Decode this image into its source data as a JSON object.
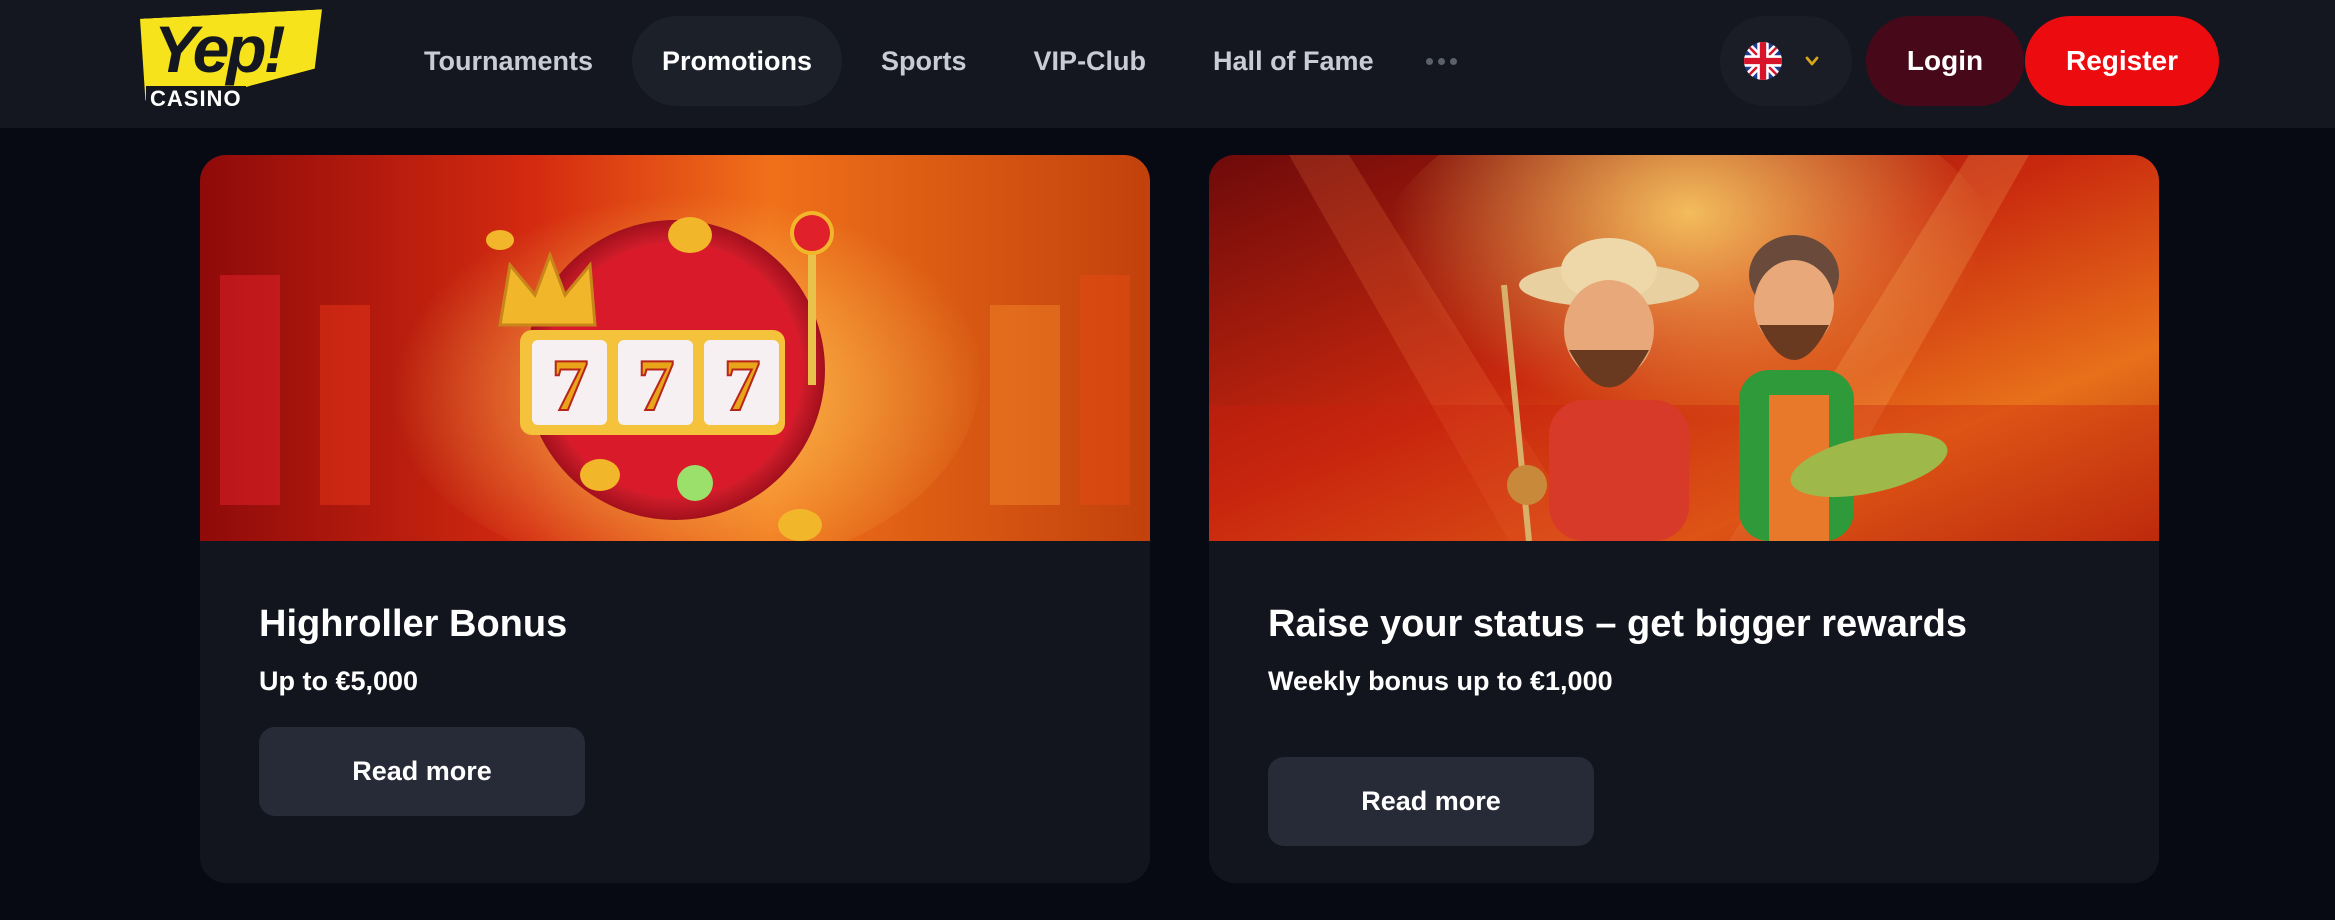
{
  "logo": {
    "brand": "Yep!",
    "sub": "CASINO"
  },
  "nav": {
    "items": [
      {
        "label": "Tournaments"
      },
      {
        "label": "Promotions",
        "active": true
      },
      {
        "label": "Sports"
      },
      {
        "label": "VIP-Club"
      },
      {
        "label": "Hall of Fame"
      }
    ],
    "more_icon": "more-dots-icon"
  },
  "language": {
    "flag": "uk-flag-icon",
    "chevron": "chevron-down-icon"
  },
  "auth": {
    "login_label": "Login",
    "register_label": "Register"
  },
  "promotions": [
    {
      "title": "Highroller Bonus",
      "subtitle": "Up to €5,000",
      "button_label": "Read more",
      "image": "slot-machine-777-image"
    },
    {
      "title": "Raise your status – get bigger rewards",
      "subtitle": "Weekly bonus up to €1,000",
      "button_label": "Read more",
      "image": "fishermen-characters-image"
    }
  ],
  "colors": {
    "brand_yellow": "#f6e31c",
    "register_red": "#ec0b0f",
    "login_maroon": "#47091a",
    "header_bg": "#14171f",
    "card_bg": "#12151d"
  }
}
